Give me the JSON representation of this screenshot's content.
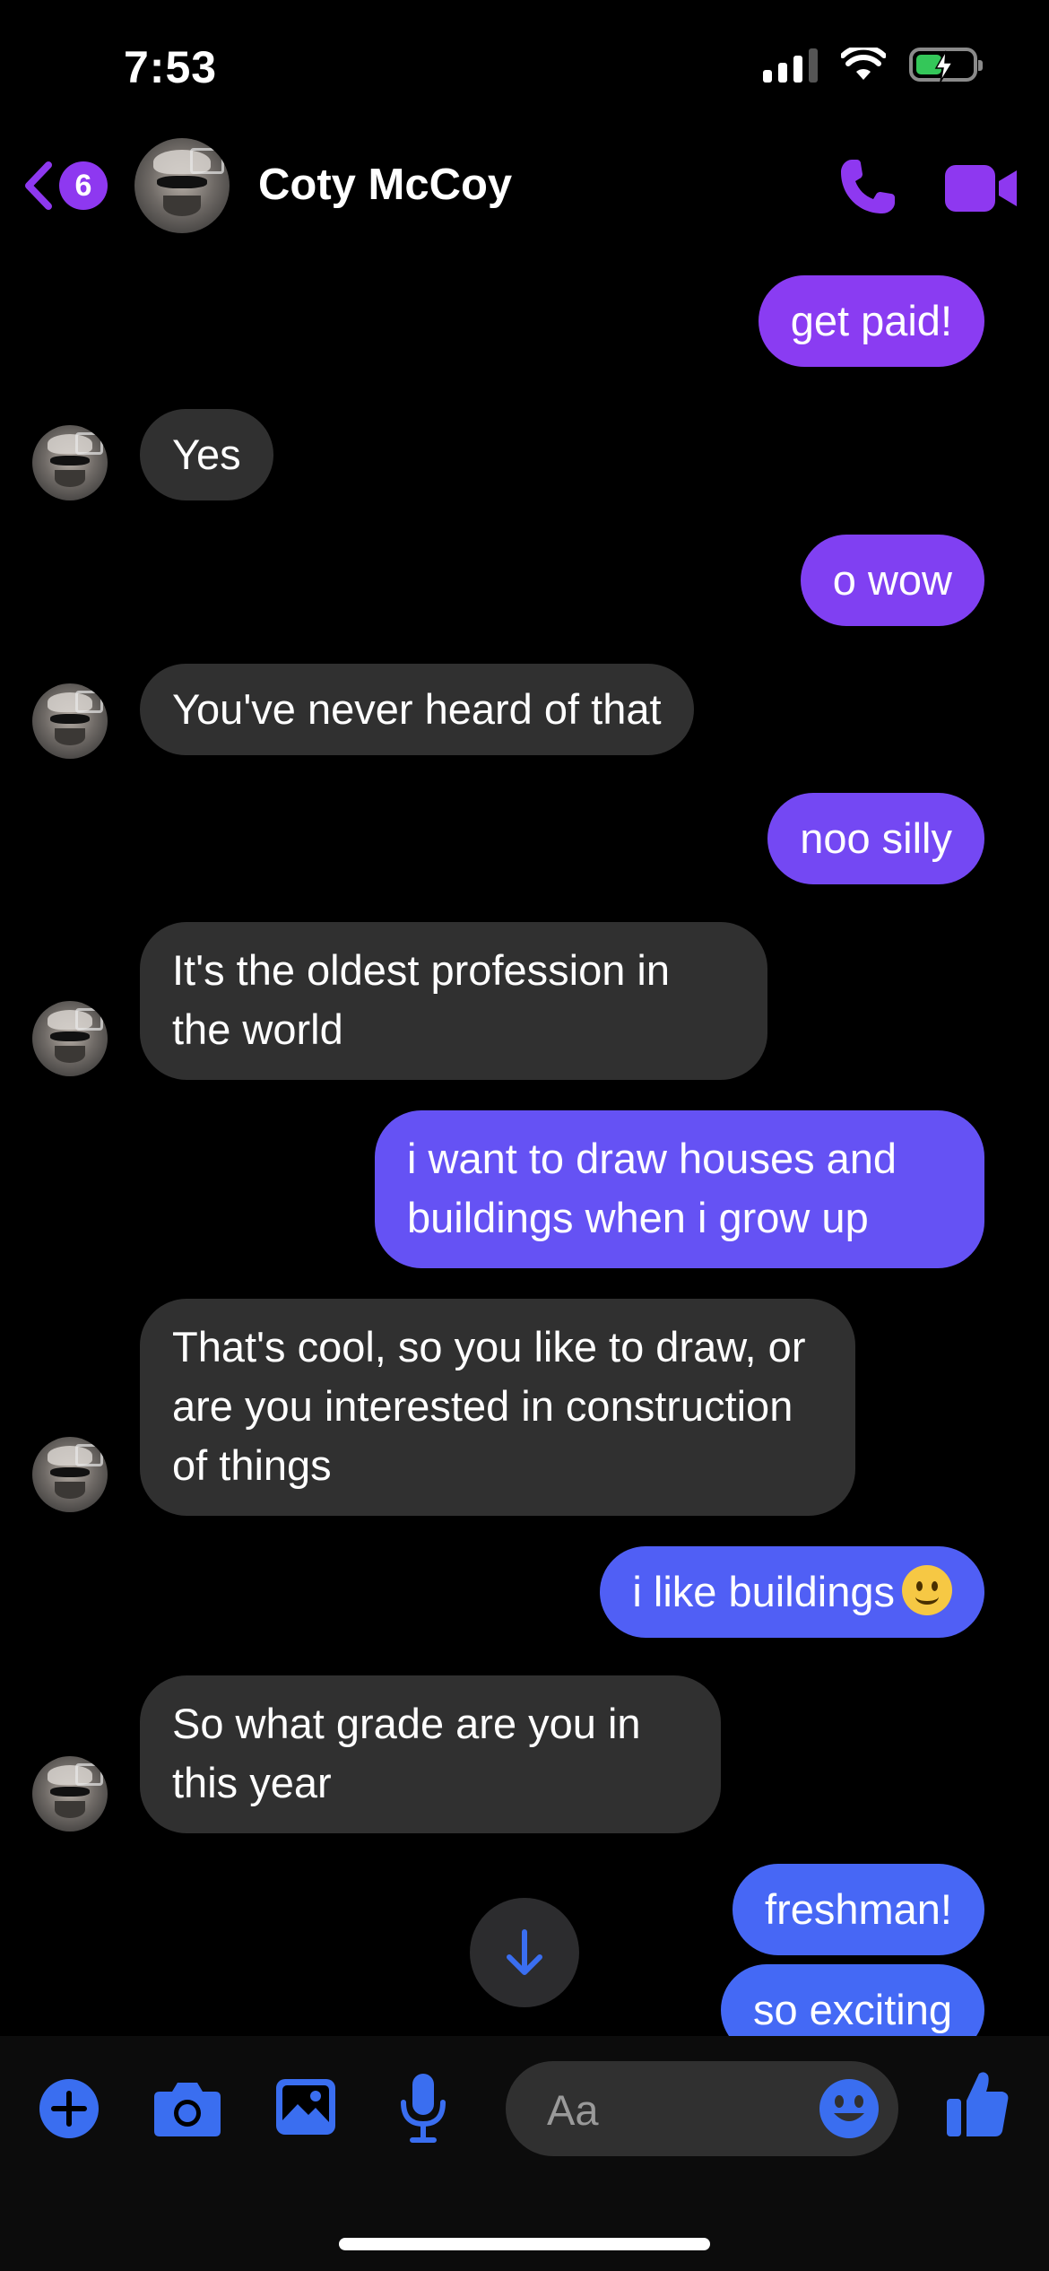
{
  "status_bar": {
    "time": "7:53"
  },
  "header": {
    "back_badge_count": "6",
    "contact_name": "Coty McCoy"
  },
  "colors": {
    "accent_purple": "#8e38f0",
    "bubble_blue": "#4a5cf5",
    "incoming_bubble": "#303030",
    "icon_blue": "#3a6ef0"
  },
  "messages": [
    {
      "direction": "outgoing",
      "text": "get paid!",
      "color": "#8a3cf2"
    },
    {
      "direction": "incoming",
      "text": "Yes"
    },
    {
      "direction": "outgoing",
      "text": "o wow",
      "color": "#8040f2"
    },
    {
      "direction": "incoming",
      "text": "You've never heard of that"
    },
    {
      "direction": "outgoing",
      "text": "noo silly",
      "color": "#7448f3"
    },
    {
      "direction": "incoming",
      "text": "It's the oldest profession in the world"
    },
    {
      "direction": "outgoing",
      "text": "i want to draw houses and buildings when i grow up",
      "color": "#6552f4"
    },
    {
      "direction": "incoming",
      "text": "That's cool, so you like to draw, or are you interested in construction of things"
    },
    {
      "direction": "outgoing",
      "text": "i like buildings",
      "emoji": "slightly-smiling-face",
      "color": "#505ff5"
    },
    {
      "direction": "incoming",
      "text": "So what grade are you in this year"
    },
    {
      "direction": "outgoing",
      "text": "freshman!",
      "color": "#4767f5"
    },
    {
      "direction": "outgoing",
      "text": "so exciting",
      "color": "#4469f5"
    }
  ],
  "composer": {
    "placeholder": "Aa",
    "icons": [
      "plus-icon",
      "camera-icon",
      "photo-icon",
      "microphone-icon",
      "emoji-icon",
      "thumbs-up-icon"
    ]
  }
}
